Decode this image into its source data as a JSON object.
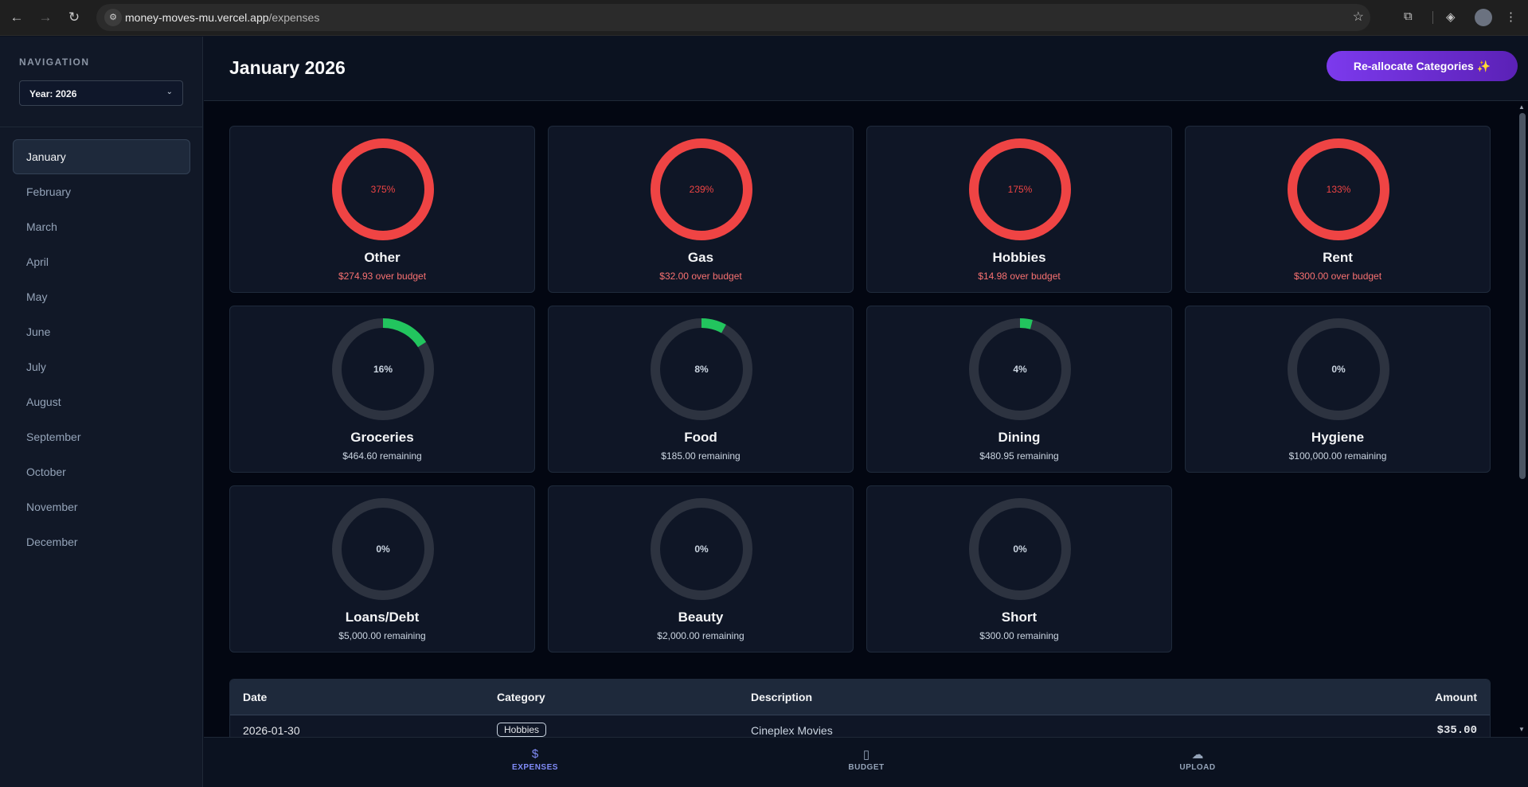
{
  "browser": {
    "url_domain": "money-moves-mu.vercel.app",
    "url_path": "/expenses"
  },
  "sidebar": {
    "title": "NAVIGATION",
    "year_select": "Year: 2026",
    "months": [
      "January",
      "February",
      "March",
      "April",
      "May",
      "June",
      "July",
      "August",
      "September",
      "October",
      "November",
      "December"
    ],
    "active_month": "January"
  },
  "header": {
    "title": "January 2026",
    "realloc_label": "Re-allocate Categories ✨"
  },
  "colors": {
    "over": "#ef4444",
    "under": "#22c55e",
    "track": "#2d3340",
    "accent": "#7c3aed"
  },
  "categories": [
    {
      "name": "Other",
      "percent_label": "375%",
      "progress": 1.0,
      "status": "over",
      "subtitle": "$274.93 over budget"
    },
    {
      "name": "Gas",
      "percent_label": "239%",
      "progress": 1.0,
      "status": "over",
      "subtitle": "$32.00 over budget"
    },
    {
      "name": "Hobbies",
      "percent_label": "175%",
      "progress": 1.0,
      "status": "over",
      "subtitle": "$14.98 over budget"
    },
    {
      "name": "Rent",
      "percent_label": "133%",
      "progress": 1.0,
      "status": "over",
      "subtitle": "$300.00 over budget"
    },
    {
      "name": "Groceries",
      "percent_label": "16%",
      "progress": 0.16,
      "status": "under",
      "subtitle": "$464.60 remaining"
    },
    {
      "name": "Food",
      "percent_label": "8%",
      "progress": 0.08,
      "status": "under",
      "subtitle": "$185.00 remaining"
    },
    {
      "name": "Dining",
      "percent_label": "4%",
      "progress": 0.04,
      "status": "under",
      "subtitle": "$480.95 remaining"
    },
    {
      "name": "Hygiene",
      "percent_label": "0%",
      "progress": 0,
      "status": "under",
      "subtitle": "$100,000.00 remaining"
    },
    {
      "name": "Loans/Debt",
      "percent_label": "0%",
      "progress": 0,
      "status": "under",
      "subtitle": "$5,000.00 remaining"
    },
    {
      "name": "Beauty",
      "percent_label": "0%",
      "progress": 0,
      "status": "under",
      "subtitle": "$2,000.00 remaining"
    },
    {
      "name": "Short",
      "percent_label": "0%",
      "progress": 0,
      "status": "under",
      "subtitle": "$300.00 remaining"
    }
  ],
  "table": {
    "headers": {
      "date": "Date",
      "category": "Category",
      "description": "Description",
      "amount": "Amount"
    },
    "rows": [
      {
        "date": "2026-01-30",
        "category": "Hobbies",
        "description": "Cineplex Movies",
        "amount": "$35.00"
      }
    ]
  },
  "bottom_nav": [
    {
      "label": "EXPENSES",
      "icon": "dollar-icon",
      "active": true
    },
    {
      "label": "BUDGET",
      "icon": "bar-chart-icon",
      "active": false
    },
    {
      "label": "UPLOAD",
      "icon": "cloud-upload-icon",
      "active": false
    }
  ]
}
